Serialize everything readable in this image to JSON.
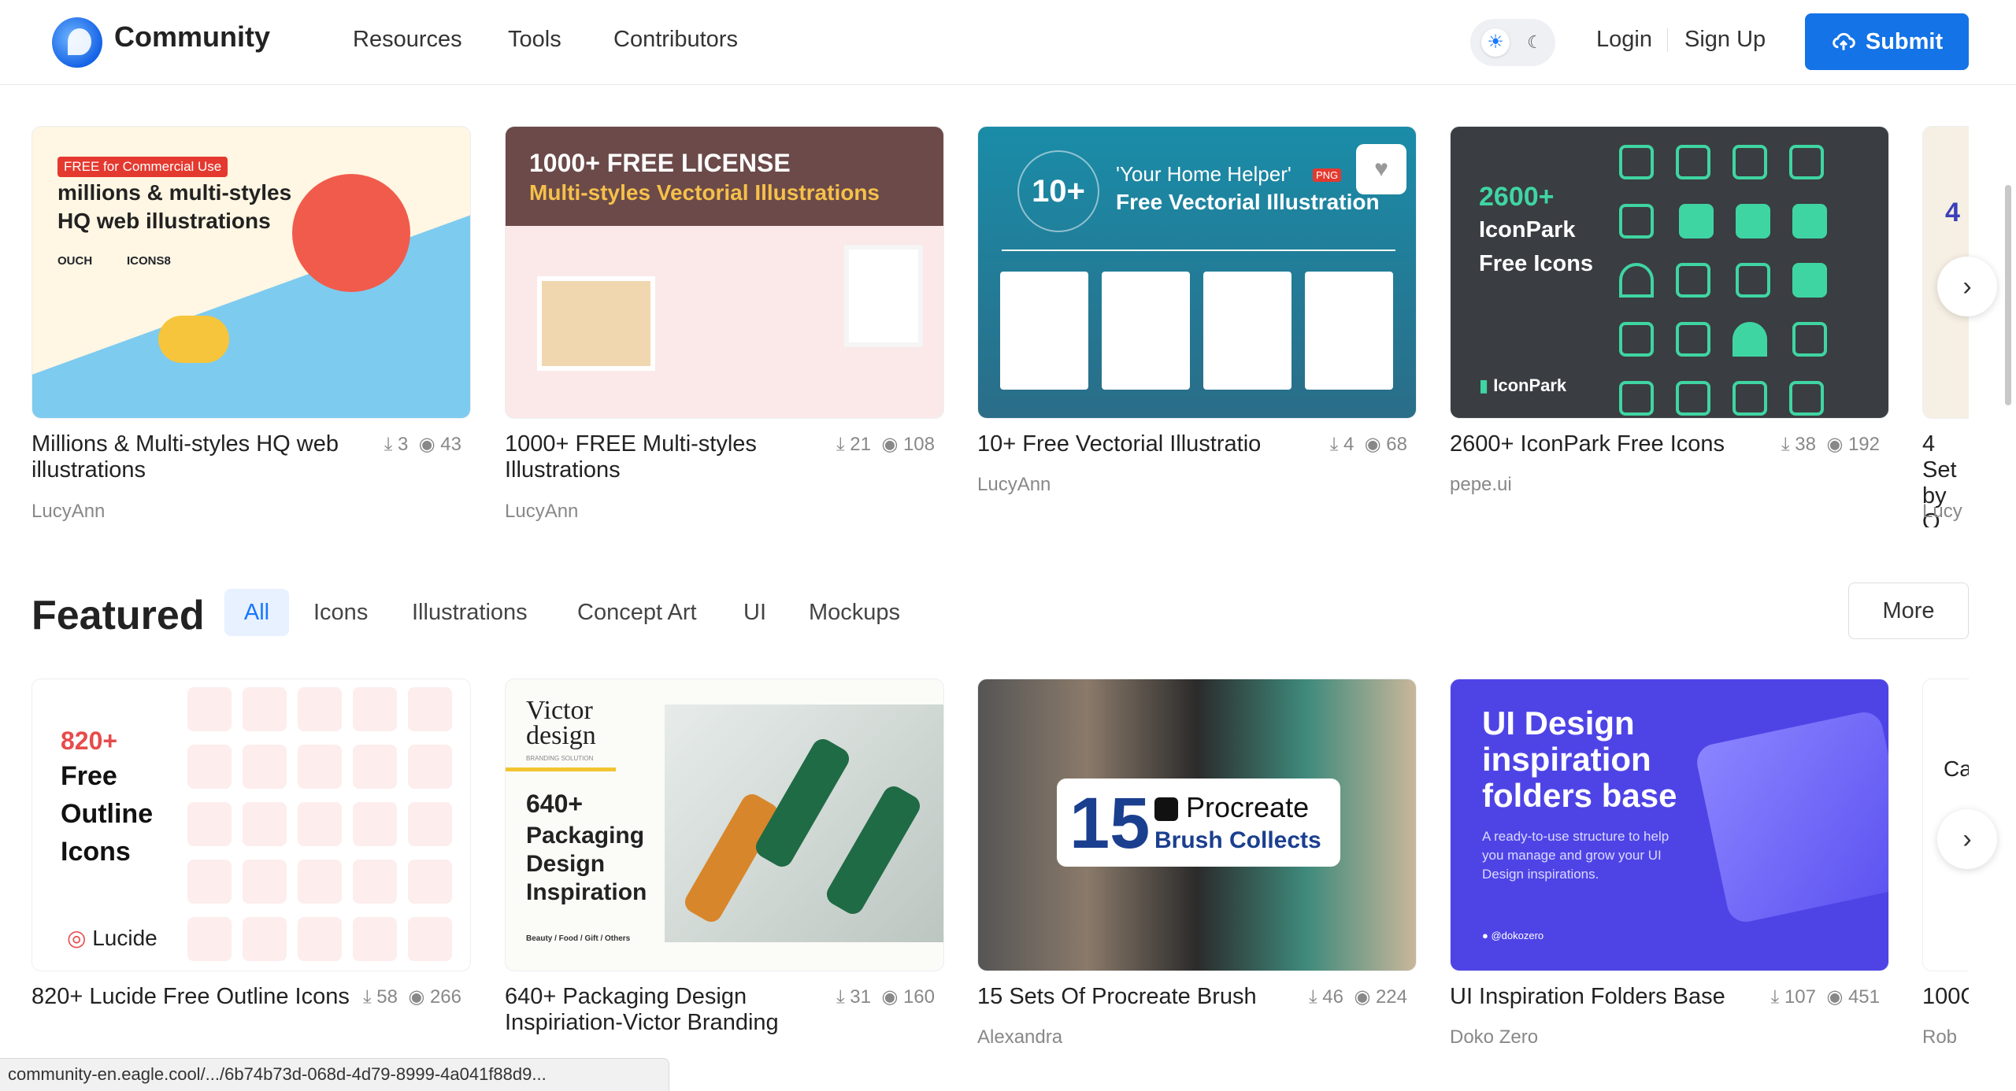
{
  "header": {
    "brand": "Community",
    "nav": [
      "Resources",
      "Tools",
      "Contributors"
    ],
    "login": "Login",
    "signup": "Sign Up",
    "submit": "Submit"
  },
  "row1": [
    {
      "title": "Millions & Multi-styles HQ web illustrations",
      "downloads": "3",
      "views": "43",
      "author": "LucyAnn",
      "thumb_badge": "FREE for Commercial Use",
      "thumb_line1": "millions & multi-styles",
      "thumb_line2": "HQ web illustrations",
      "thumb_b1": "OUCH",
      "thumb_b2": "ICONS8"
    },
    {
      "title": "1000+ FREE Multi-styles Illustrations",
      "downloads": "21",
      "views": "108",
      "author": "LucyAnn",
      "thumb_line1": "1000+  FREE LICENSE",
      "thumb_line2": "Multi-styles Vectorial Illustrations"
    },
    {
      "title": "10+ Free Vectorial Illustratio",
      "downloads": "4",
      "views": "68",
      "author": "LucyAnn",
      "thumb_num": "10+",
      "thumb_line1": "'Your Home Helper'",
      "thumb_png": "PNG",
      "thumb_line2": "Free Vectorial Illustration"
    },
    {
      "title": "2600+ IconPark Free Icons",
      "downloads": "38",
      "views": "192",
      "author": "pepe.ui",
      "thumb_line1": "2600+",
      "thumb_line2": "IconPark",
      "thumb_line3": "Free Icons",
      "thumb_logo": "IconPark"
    },
    {
      "title": "4 Set by O",
      "author": "Lucy",
      "thumb_text": "4"
    }
  ],
  "featured": {
    "heading": "Featured",
    "tabs": [
      "All",
      "Icons",
      "Illustrations",
      "Concept Art",
      "UI",
      "Mockups"
    ],
    "more": "More"
  },
  "row2": [
    {
      "title": "820+ Lucide Free Outline Icons",
      "downloads": "58",
      "views": "266",
      "thumb_num": "820+",
      "thumb_l1": "Free",
      "thumb_l2": "Outline",
      "thumb_l3": "Icons",
      "thumb_logo": "Lucide"
    },
    {
      "title": "640+ Packaging Design Inspiriation-Victor Branding",
      "downloads": "31",
      "views": "160",
      "thumb_brand": "Victor design",
      "thumb_sub": "BRANDING SOLUTION",
      "thumb_num": "640+",
      "thumb_l1": "Packaging",
      "thumb_l2": "Design",
      "thumb_l3": "Inspiration",
      "thumb_foot": "Beauty / Food / Gift / Others"
    },
    {
      "title": "15 Sets Of Procreate Brush",
      "downloads": "46",
      "views": "224",
      "author": "Alexandra",
      "thumb_num": "15",
      "thumb_l1": "Procreate",
      "thumb_l2": "Brush Collects"
    },
    {
      "title": "UI Inspiration Folders Base",
      "downloads": "107",
      "views": "451",
      "author": "Doko Zero",
      "thumb_l1": "UI Design",
      "thumb_l2": "inspiration",
      "thumb_l3": "folders base",
      "thumb_desc": "A ready-to-use structure to help you manage and grow your UI Design inspirations.",
      "thumb_handle": "@dokozero"
    },
    {
      "title": "100C",
      "author": "Rob",
      "thumb_text": "Ca"
    }
  ],
  "status_url": "community-en.eagle.cool/.../6b74b73d-068d-4d79-8999-4a041f88d9..."
}
